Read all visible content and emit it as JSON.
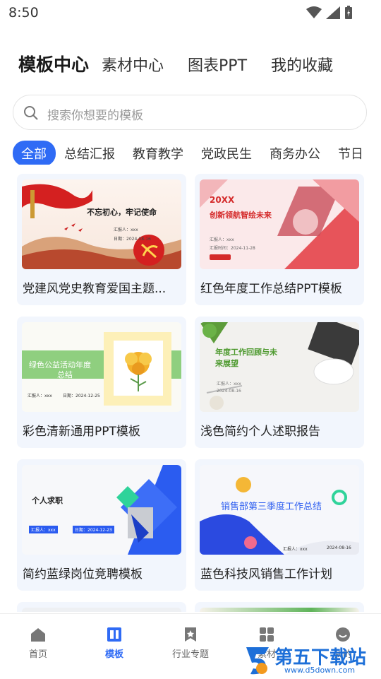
{
  "status_bar": {
    "time": "8:50"
  },
  "top_tabs": [
    {
      "label": "模板中心",
      "active": true
    },
    {
      "label": "素材中心"
    },
    {
      "label": "图表PPT"
    },
    {
      "label": "我的收藏"
    }
  ],
  "search": {
    "placeholder": "搜索你想要的模板"
  },
  "categories": [
    {
      "label": "全部",
      "active": true
    },
    {
      "label": "总结汇报"
    },
    {
      "label": "教育教学"
    },
    {
      "label": "党政民生"
    },
    {
      "label": "商务办公"
    },
    {
      "label": "节日"
    }
  ],
  "templates": [
    {
      "title": "党建风党史教育爱国主题...",
      "thumb": {
        "heading": "不忘初心，牢记使命",
        "line1": "汇报人：xxx",
        "line2": "日期：2024-08-16"
      }
    },
    {
      "title": "红色年度工作总结PPT模板",
      "thumb": {
        "year": "20XX",
        "heading": "创新领航智绘未来",
        "line1": "汇报人：xxx",
        "line2": "汇报时间：2024-11-28"
      }
    },
    {
      "title": "彩色清新通用PPT模板",
      "thumb": {
        "heading_1": "绿色公益活动年度",
        "heading_2": "总结",
        "line1": "汇报人：xxx",
        "line2": "日期：2024-12-25"
      }
    },
    {
      "title": "浅色简约个人述职报告",
      "thumb": {
        "heading_1": "年度工作回顾与未",
        "heading_2": "来展望",
        "line1": "汇报人：xxx",
        "line2": "2024-08-16"
      }
    },
    {
      "title": "简约蓝绿岗位竞聘模板",
      "thumb": {
        "heading": "个人求职",
        "line1": "汇报人：xxx",
        "line2": "日期：2024-12-23"
      }
    },
    {
      "title": "蓝色科技风销售工作计划",
      "thumb": {
        "heading": "销售部第三季度工作总结",
        "line1": "汇报人：xxx",
        "line2": "2024-08-16"
      }
    }
  ],
  "bottom_nav": [
    {
      "label": "首页",
      "icon": "home-icon"
    },
    {
      "label": "模板",
      "icon": "template-icon",
      "active": true
    },
    {
      "label": "行业专题",
      "icon": "bookmark-icon"
    },
    {
      "label": "素材",
      "icon": "grid-icon"
    },
    {
      "label": "我的",
      "icon": "smile-icon"
    }
  ],
  "watermark": {
    "text": "第五下载站",
    "url": "www.d5down.com"
  },
  "colors": {
    "accent": "#2f6bf5",
    "card_bg": "#f2f6fd",
    "red": "#d42a2a",
    "green": "#5aa65a"
  }
}
